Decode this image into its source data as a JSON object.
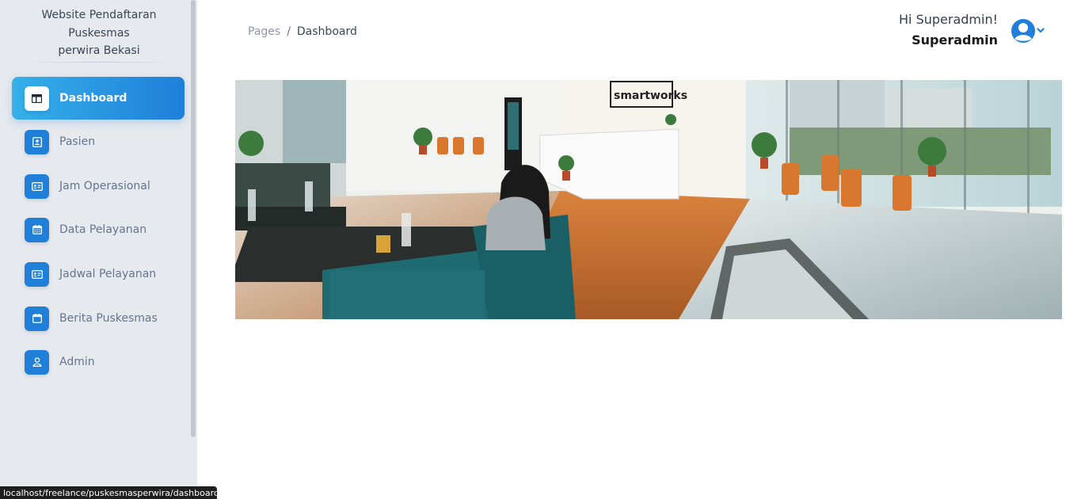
{
  "brand": {
    "line1": "Website Pendaftaran",
    "line2": "Puskesmas",
    "line3": "perwira Bekasi"
  },
  "sidebar": {
    "items": [
      {
        "label": "Dashboard",
        "icon": "dashboard-icon",
        "active": true
      },
      {
        "label": "Pasien",
        "icon": "patient-card-icon",
        "active": false
      },
      {
        "label": "Jam Operasional",
        "icon": "id-card-icon",
        "active": false
      },
      {
        "label": "Data Pelayanan",
        "icon": "calendar-grid-icon",
        "active": false
      },
      {
        "label": "Jadwal Pelayanan",
        "icon": "id-card-icon",
        "active": false
      },
      {
        "label": "Berita Puskesmas",
        "icon": "calendar-icon",
        "active": false
      },
      {
        "label": "Admin",
        "icon": "user-icon",
        "active": false
      }
    ]
  },
  "breadcrumb": {
    "root": "Pages",
    "separator": "/",
    "current": "Dashboard"
  },
  "header": {
    "greeting": "Hi Superadmin!",
    "username": "Superadmin"
  },
  "banner": {
    "logo_text": "smartworks"
  },
  "status_url": "localhost/freelance/puskesmasperwira/dashboard",
  "colors": {
    "accent": "#1f7fd9",
    "accent_light": "#35b0e9",
    "sidebar_bg": "#e6eaef"
  }
}
